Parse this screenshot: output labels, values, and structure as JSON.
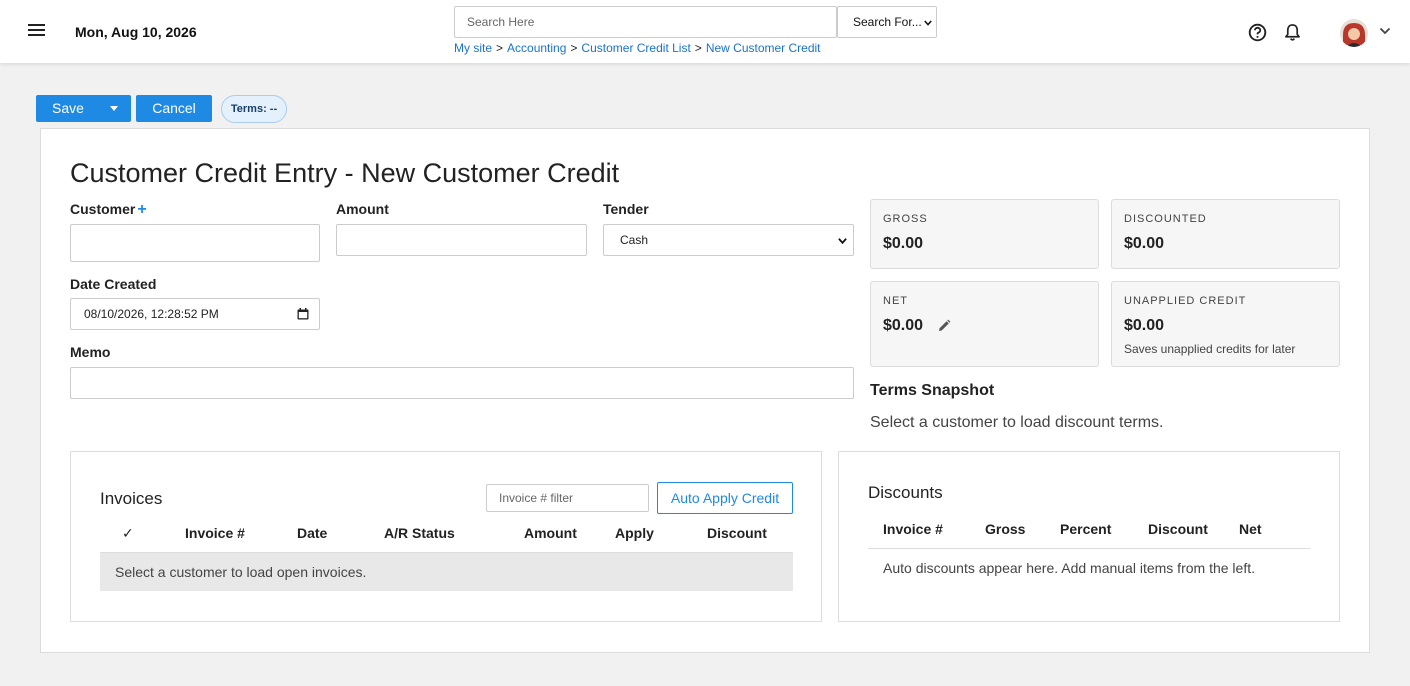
{
  "header": {
    "date": "Mon, Aug 10, 2026",
    "search_placeholder": "Search Here",
    "search_scope": "Search For...",
    "breadcrumb": [
      "My site",
      "Accounting",
      "Customer Credit List",
      "New Customer Credit"
    ],
    "separator": ">"
  },
  "toolbar": {
    "save_label": "Save",
    "cancel_label": "Cancel",
    "terms_badge": "Terms: --"
  },
  "page": {
    "title": "Customer Credit Entry - New Customer Credit"
  },
  "form": {
    "customer_label": "Customer",
    "customer_add": "+",
    "amount_label": "Amount",
    "tender_label": "Tender",
    "tender_value": "Cash",
    "date_created_label": "Date Created",
    "date_created_value": "08/10/2026, 12:28:52 PM",
    "memo_label": "Memo"
  },
  "stats": {
    "gross_label": "GROSS",
    "gross_value": "$0.00",
    "discounted_label": "DISCOUNTED",
    "discounted_value": "$0.00",
    "net_label": "NET",
    "net_value": "$0.00",
    "unapplied_label": "UNAPPLIED CREDIT",
    "unapplied_value": "$0.00",
    "unapplied_note": "Saves unapplied credits for later"
  },
  "terms_snapshot": {
    "title": "Terms Snapshot",
    "text": "Select a customer to load discount terms."
  },
  "invoices": {
    "title": "Invoices",
    "filter_placeholder": "Invoice # filter",
    "auto_apply_label": "Auto Apply Credit",
    "columns": [
      "✓",
      "Invoice #",
      "Date",
      "A/R Status",
      "Amount",
      "Apply",
      "Discount"
    ],
    "empty_message": "Select a customer to load open invoices."
  },
  "discounts": {
    "title": "Discounts",
    "columns": [
      "Invoice #",
      "Gross",
      "Percent",
      "Discount",
      "Net"
    ],
    "empty_message": "Auto discounts appear here. Add manual items from the left."
  },
  "colors": {
    "accent": "#1f8ae3",
    "link": "#1a73c9",
    "background": "#f1f1f1"
  }
}
